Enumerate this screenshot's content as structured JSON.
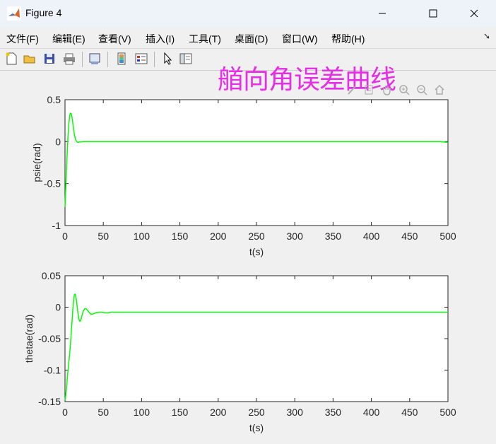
{
  "window": {
    "title": "Figure 4"
  },
  "menu": [
    "文件(F)",
    "编辑(E)",
    "查看(V)",
    "插入(I)",
    "工具(T)",
    "桌面(D)",
    "窗口(W)",
    "帮助(H)"
  ],
  "overlay_title": "艏向角误差曲线",
  "chart_data": [
    {
      "type": "line",
      "xlabel": "t(s)",
      "ylabel": "psie(rad)",
      "xlim": [
        0,
        500
      ],
      "ylim": [
        -1,
        0.5
      ],
      "xticks": [
        "0",
        "50",
        "100",
        "150",
        "200",
        "250",
        "300",
        "350",
        "400",
        "450",
        "500"
      ],
      "yticks": [
        "-1",
        "-0.5",
        "0",
        "0.5"
      ],
      "grid": false,
      "color": "#00ff00",
      "series": [
        {
          "x": [
            0,
            1,
            2,
            3,
            4,
            5,
            6,
            7,
            8,
            9,
            10,
            11,
            12,
            13,
            14,
            15,
            16,
            17,
            18,
            20,
            22,
            25,
            30,
            40,
            60,
            100,
            200,
            300,
            400,
            490,
            500
          ],
          "y": [
            -0.78,
            -0.55,
            -0.32,
            -0.1,
            0.08,
            0.21,
            0.3,
            0.34,
            0.335,
            0.3,
            0.24,
            0.17,
            0.1,
            0.05,
            0.02,
            0.005,
            -0.005,
            -0.008,
            -0.006,
            -0.003,
            -0.001,
            0,
            0,
            0,
            0,
            0,
            0,
            0,
            0,
            0,
            -0.01
          ]
        }
      ]
    },
    {
      "type": "line",
      "xlabel": "t(s)",
      "ylabel": "thetae(rad)",
      "xlim": [
        0,
        500
      ],
      "ylim": [
        -0.15,
        0.05
      ],
      "xticks": [
        "0",
        "50",
        "100",
        "150",
        "200",
        "250",
        "300",
        "350",
        "400",
        "450",
        "500"
      ],
      "yticks": [
        "-0.15",
        "-0.1",
        "-0.05",
        "0",
        "0.05"
      ],
      "grid": false,
      "color": "#00ff00",
      "series": [
        {
          "x": [
            0,
            1,
            2,
            3,
            4,
            5,
            6,
            7,
            8,
            9,
            10,
            11,
            12,
            13,
            14,
            15,
            16,
            17,
            18,
            19,
            20,
            21,
            22,
            24,
            26,
            28,
            30,
            32,
            34,
            36,
            38,
            40,
            44,
            48,
            52,
            56,
            60,
            80,
            100,
            200,
            300,
            400,
            500
          ],
          "y": [
            -0.148,
            -0.14,
            -0.128,
            -0.112,
            -0.1,
            -0.088,
            -0.075,
            -0.06,
            -0.042,
            -0.025,
            -0.008,
            0.008,
            0.018,
            0.021,
            0.018,
            0.01,
            0.0,
            -0.01,
            -0.018,
            -0.022,
            -0.022,
            -0.019,
            -0.014,
            -0.006,
            -0.002,
            -0.003,
            -0.006,
            -0.009,
            -0.011,
            -0.011,
            -0.01,
            -0.009,
            -0.008,
            -0.008,
            -0.009,
            -0.009,
            -0.008,
            -0.008,
            -0.008,
            -0.008,
            -0.008,
            -0.008,
            -0.008
          ]
        }
      ]
    }
  ]
}
